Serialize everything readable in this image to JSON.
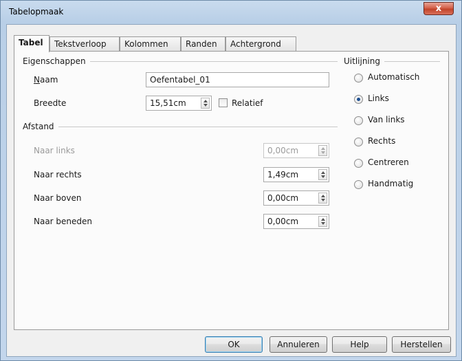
{
  "window": {
    "title": "Tabelopmaak",
    "close_label": "x"
  },
  "tabs": [
    {
      "label": "Tabel",
      "active": true
    },
    {
      "label": "Tekstverloop"
    },
    {
      "label": "Kolommen"
    },
    {
      "label": "Randen"
    },
    {
      "label": "Achtergrond"
    }
  ],
  "properties": {
    "heading": "Eigenschappen",
    "name_label": "Naam",
    "name_value": "Oefentabel_01",
    "width_label": "Breedte",
    "width_value": "15,51cm",
    "relative_label": "Relatief",
    "relative_checked": false
  },
  "spacing": {
    "heading": "Afstand",
    "left_label": "Naar links",
    "left_value": "0,00cm",
    "right_label": "Naar rechts",
    "right_value": "1,49cm",
    "top_label": "Naar boven",
    "top_value": "0,00cm",
    "bottom_label": "Naar beneden",
    "bottom_value": "0,00cm"
  },
  "alignment": {
    "heading": "Uitlijning",
    "options": [
      "Automatisch",
      "Links",
      "Van links",
      "Rechts",
      "Centreren",
      "Handmatig"
    ],
    "selected": "Links"
  },
  "buttons": {
    "ok": "OK",
    "cancel": "Annuleren",
    "help": "Help",
    "reset": "Herstellen"
  }
}
